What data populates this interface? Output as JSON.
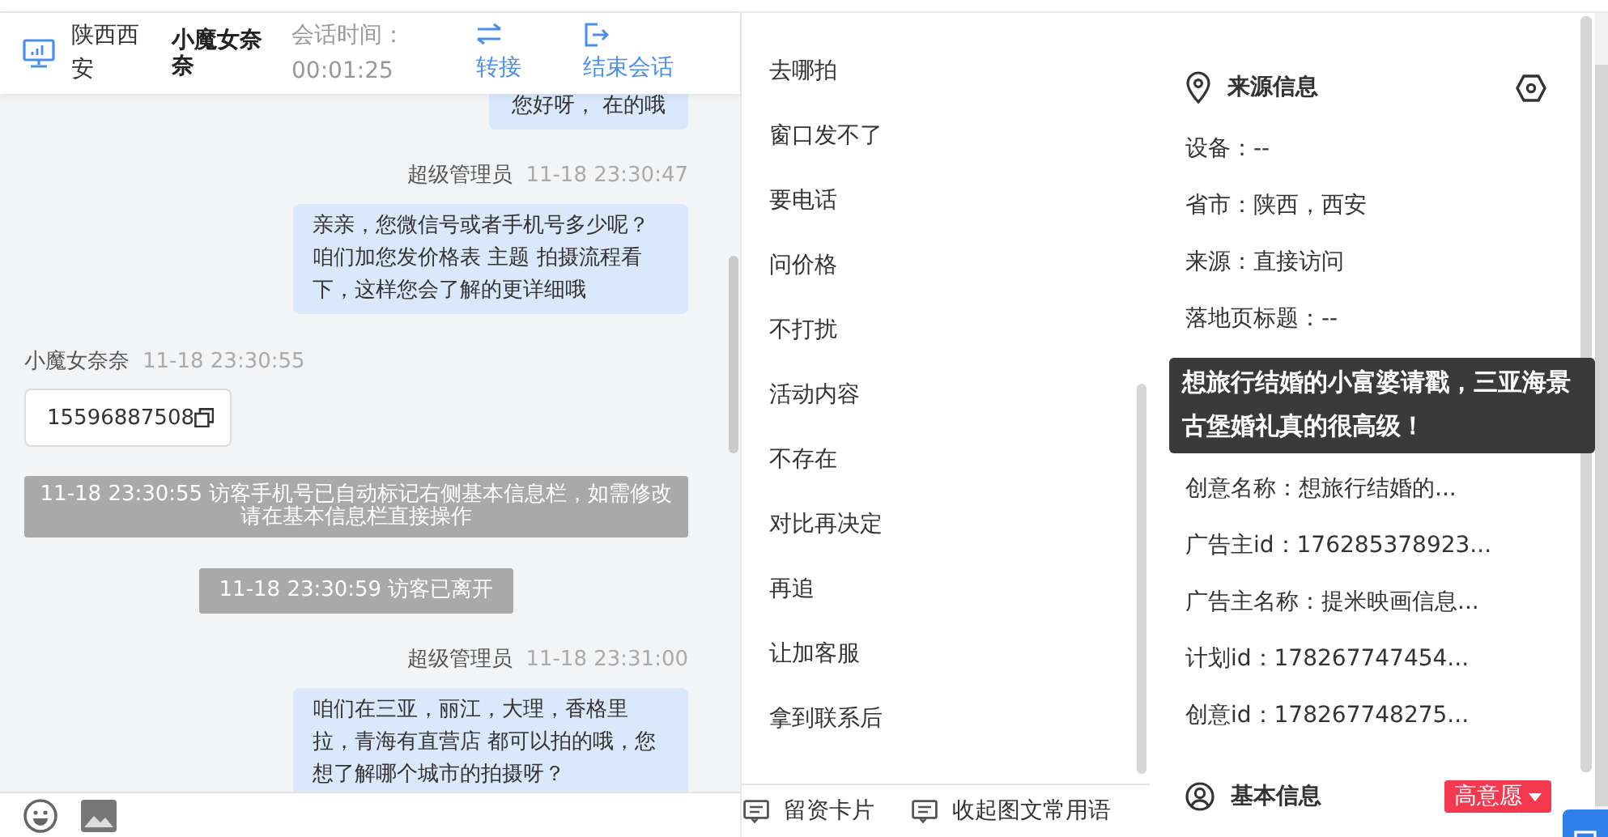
{
  "header": {
    "location": "陕西西安",
    "visitor": "小魔女奈奈",
    "duration_label": "会话时间：",
    "duration": "00:01:25",
    "actions": [
      {
        "kind": "transfer",
        "label": "转接"
      },
      {
        "kind": "end",
        "label": "结束会话"
      }
    ]
  },
  "messages": [
    {
      "kind": "agent",
      "text": "您好呀， 在的哦"
    },
    {
      "kind": "agent",
      "sender": "超级管理员",
      "time": "11-18 23:30:47",
      "text": "亲亲，您微信号或者手机号多少呢？咱们加您发价格表 主题 拍摄流程看下，这样您会了解的更详细哦"
    },
    {
      "kind": "visitor",
      "sender": "小魔女奈奈",
      "time": "11-18 23:30:55",
      "text": "15596887508"
    },
    {
      "kind": "system",
      "text": "11-18 23:30:55 访客手机号已自动标记右侧基本信息栏，如需修改请在基本信息栏直接操作"
    },
    {
      "kind": "system",
      "text": "11-18 23:30:59 访客已离开"
    },
    {
      "kind": "agent",
      "sender": "超级管理员",
      "time": "11-18 23:31:00",
      "text": "咱们在三亚，丽江，大理，香格里拉，青海有直营店 都可以拍的哦，您想了解哪个城市的拍摄呀？"
    }
  ],
  "quick_replies": {
    "items": [
      "去哪拍",
      "窗口发不了",
      "要电话",
      "问价格",
      "不打扰",
      "活动内容",
      "不存在",
      "对比再决定",
      "再追",
      "让加客服",
      "拿到联系后"
    ],
    "footer": [
      "留资卡片",
      "收起图文常用语"
    ]
  },
  "source_info": {
    "title": "来源信息",
    "rows_before": [
      "设备：--",
      "省市：陕西，西安",
      "来源：直接访问",
      "落地页标题：--"
    ],
    "rows_after": [
      "创意名称：想旅行结婚的...",
      "广告主id：176285378923...",
      "广告主名称：提米映画信息...",
      "计划id：178267747454...",
      "创意id：178267748275..."
    ]
  },
  "tooltip": {
    "text": "想旅行结婚的小富婆请戳，三亚海景古堡婚礼真的很高级！"
  },
  "basic_info": {
    "title": "基本信息",
    "intent": "高意愿"
  }
}
